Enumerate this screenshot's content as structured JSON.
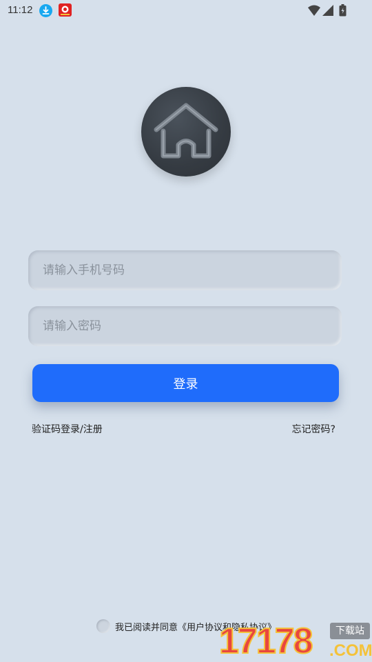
{
  "status_bar": {
    "time": "11:12"
  },
  "login": {
    "phone_placeholder": "请输入手机号码",
    "password_placeholder": "请输入密码",
    "login_button": "登录",
    "sms_login_link": "验证码登录/注册",
    "forgot_password_link": "忘记密码?"
  },
  "agreement": {
    "prefix": "我已阅读并同意",
    "link": "《用户协议和隐私协议》"
  },
  "watermark": {
    "number": "17178",
    "badge": "下载站",
    "domain": ".COM"
  },
  "colors": {
    "background": "#d6e0eb",
    "primary": "#1f6cfb",
    "field": "#cbd4df"
  }
}
